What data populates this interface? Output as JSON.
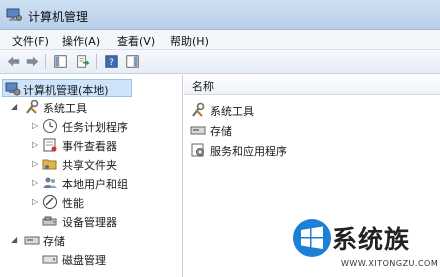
{
  "window": {
    "title": "计算机管理"
  },
  "menu": {
    "items": [
      "文件(F)",
      "操作(A)",
      "查看(V)",
      "帮助(H)"
    ]
  },
  "toolbar": {
    "buttons": [
      "back-arrow-icon",
      "forward-arrow-icon",
      "console-tree-icon",
      "export-list-icon",
      "help-icon",
      "show-hide-pane-icon"
    ]
  },
  "tree": {
    "root": "计算机管理(本地)",
    "system_tools": "系统工具",
    "task_scheduler": "任务计划程序",
    "event_viewer": "事件查看器",
    "shared_folders": "共享文件夹",
    "local_users": "本地用户和组",
    "performance": "性能",
    "device_manager": "设备管理器",
    "storage": "存储",
    "disk_management": "磁盘管理"
  },
  "list": {
    "column_name": "名称",
    "items": [
      "系统工具",
      "存储",
      "服务和应用程序"
    ]
  },
  "watermark": {
    "brand": "系统族",
    "url": "WWW.XITONGZU.COM"
  }
}
